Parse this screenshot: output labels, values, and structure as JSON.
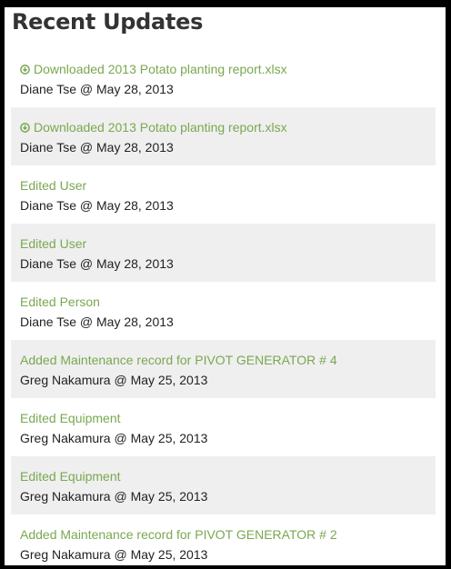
{
  "title": "Recent Updates",
  "updates": [
    {
      "action": "Downloaded 2013 Potato planting report.xlsx",
      "meta": "Diane Tse @ May 28, 2013",
      "icon": "download-icon"
    },
    {
      "action": "Downloaded 2013 Potato planting report.xlsx",
      "meta": "Diane Tse @ May 28, 2013",
      "icon": "download-icon"
    },
    {
      "action": "Edited User",
      "meta": "Diane Tse @ May 28, 2013"
    },
    {
      "action": "Edited User",
      "meta": "Diane Tse @ May 28, 2013"
    },
    {
      "action": "Edited Person",
      "meta": "Diane Tse @ May 28, 2013"
    },
    {
      "action": "Added Maintenance record for PIVOT GENERATOR # 4",
      "meta": "Greg Nakamura @ May 25, 2013"
    },
    {
      "action": "Edited Equipment",
      "meta": "Greg Nakamura @ May 25, 2013"
    },
    {
      "action": "Edited Equipment",
      "meta": "Greg Nakamura @ May 25, 2013"
    },
    {
      "action": "Added Maintenance record for PIVOT GENERATOR # 2",
      "meta": "Greg Nakamura @ May 25, 2013"
    }
  ],
  "colors": {
    "link": "#79a850",
    "alt_row": "#efefef",
    "text": "#222222",
    "title": "#333333"
  }
}
